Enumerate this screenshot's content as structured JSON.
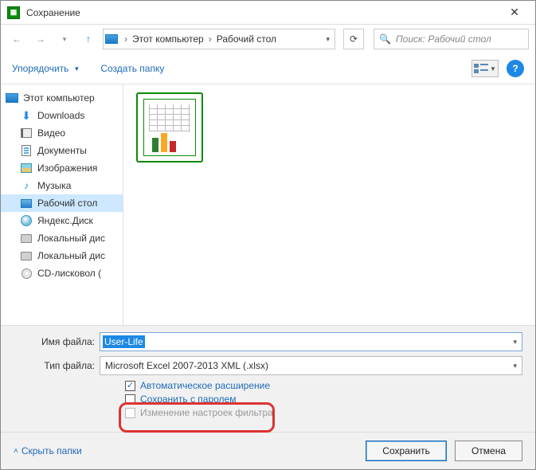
{
  "titlebar": {
    "title": "Сохранение",
    "close_glyph": "✕"
  },
  "nav": {
    "breadcrumb": {
      "root": "Этот компьютер",
      "current": "Рабочий стол"
    },
    "search_placeholder": "Поиск: Рабочий стол"
  },
  "toolbar": {
    "organize": "Упорядочить",
    "new_folder": "Создать папку",
    "help_glyph": "?"
  },
  "sidebar": {
    "items": [
      {
        "label": "Этот компьютер"
      },
      {
        "label": "Downloads"
      },
      {
        "label": "Видео"
      },
      {
        "label": "Документы"
      },
      {
        "label": "Изображения"
      },
      {
        "label": "Музыка"
      },
      {
        "label": "Рабочий стол"
      },
      {
        "label": "Яндекс.Диск"
      },
      {
        "label": "Локальный дис"
      },
      {
        "label": "Локальный дис"
      },
      {
        "label": "CD-лисковол ("
      }
    ]
  },
  "form": {
    "filename_label": "Имя файла:",
    "filename_value": "User-Life",
    "type_label": "Тип файла:",
    "type_value": "Microsoft Excel 2007-2013 XML (.xlsx)",
    "checks": {
      "auto_ext": "Автоматическое расширение",
      "save_password": "Сохранить с паролем",
      "filter_settings": "Изменение настроек фильтра"
    }
  },
  "footer": {
    "hide_folders": "Скрыть папки",
    "save": "Сохранить",
    "cancel": "Отмена"
  }
}
